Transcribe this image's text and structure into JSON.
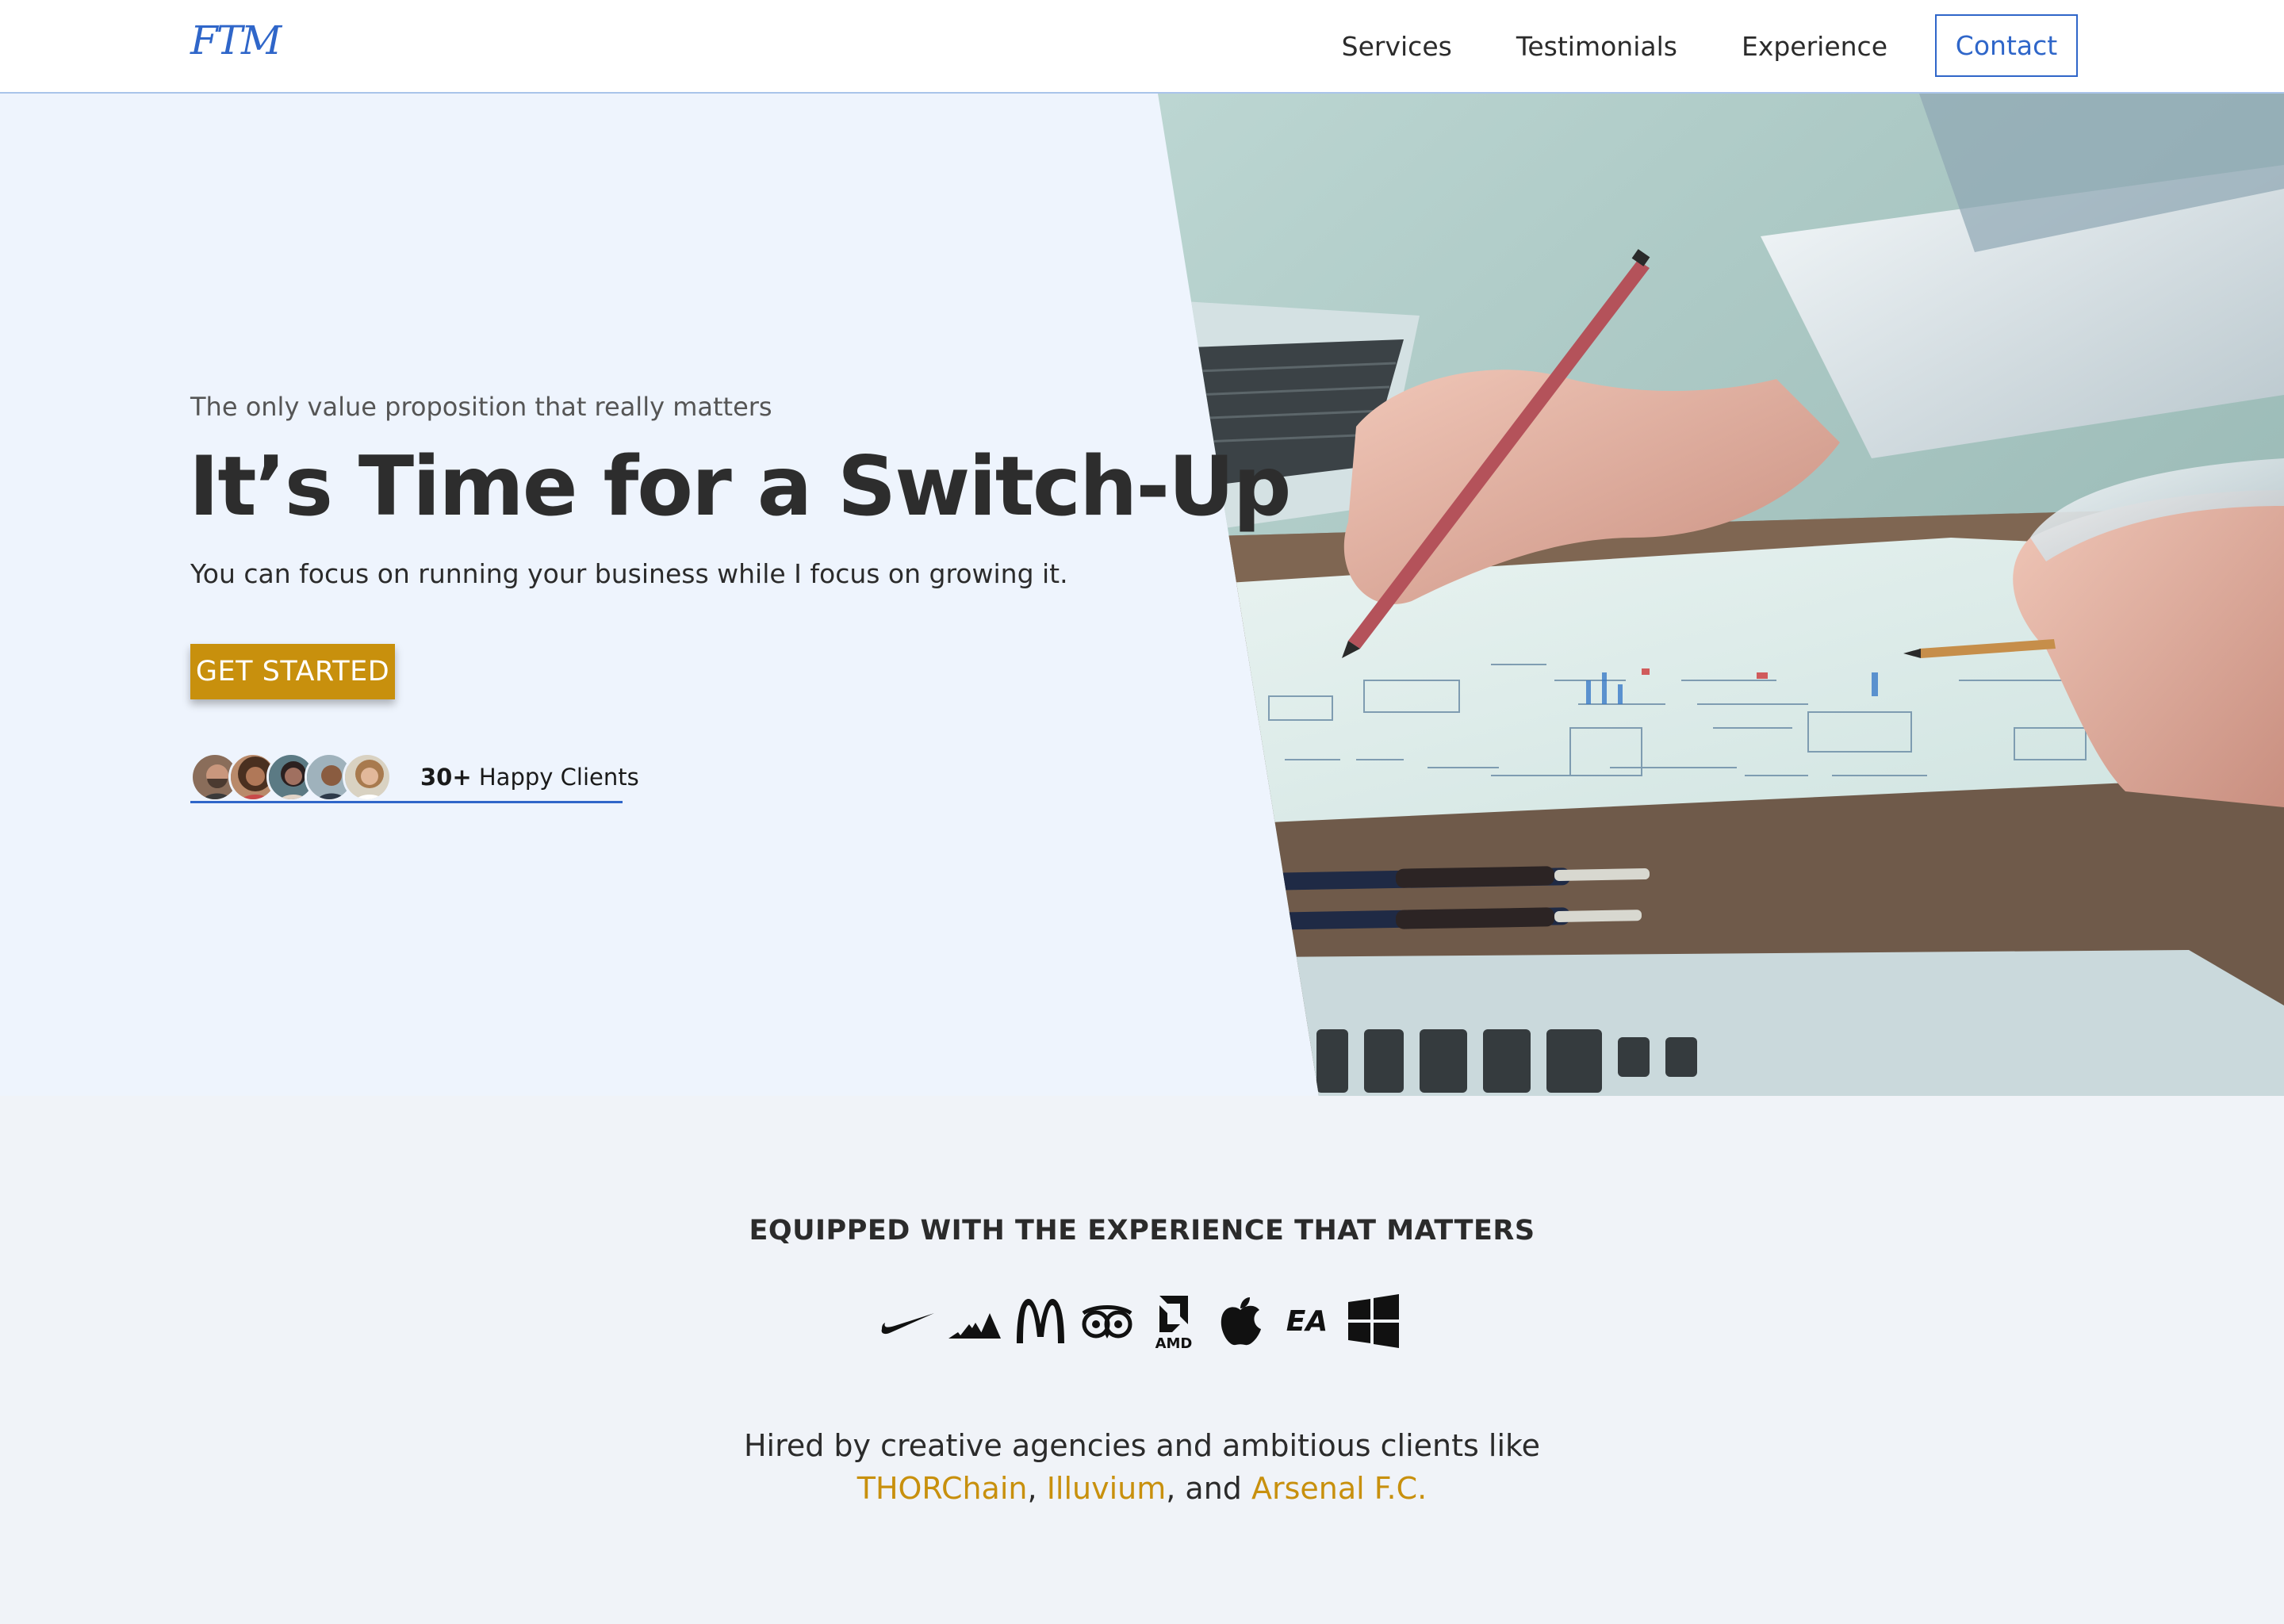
{
  "nav": {
    "logo": "FTM",
    "links": [
      "Services",
      "Testimonials",
      "Experience"
    ],
    "contact_label": "Contact"
  },
  "hero": {
    "eyebrow": "The only value proposition that really matters",
    "headline": "It’s Time for a Switch-Up",
    "subline": "You can focus on running your business while I focus on growing it.",
    "cta_label": "GET STARTED",
    "clients_count": "30+",
    "clients_label": "Happy Clients"
  },
  "experience": {
    "title": "EQUIPPED WITH THE EXPERIENCE THAT MATTERS",
    "brand_logos": [
      "nike-logo",
      "adidas-logo",
      "mcdonalds-logo",
      "tripadvisor-logo",
      "amd-logo",
      "apple-logo",
      "ea-logo",
      "windows-logo"
    ],
    "hired_line1": "Hired by creative agencies and ambitious clients like",
    "client1": "THORChain",
    "client2": "Illuvium",
    "client3": "Arsenal F.C.",
    "sep1": ",",
    "sep2": ", and"
  },
  "colors": {
    "accent_blue": "#2f66c9",
    "accent_gold": "#c8900d",
    "hero_bg": "#eef4fd",
    "section_bg": "#f0f3f8"
  }
}
